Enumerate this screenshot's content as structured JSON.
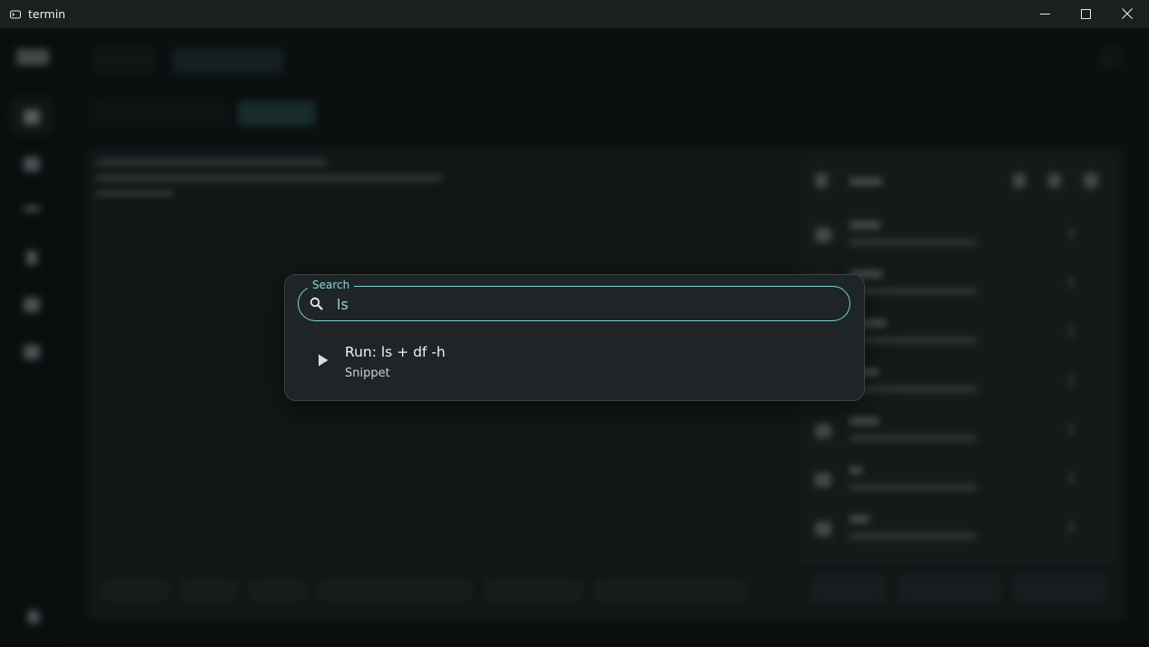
{
  "window": {
    "title": "termin",
    "app_icon": "terminal-cloud-icon",
    "controls": [
      "minimize-icon",
      "maximize-icon",
      "close-icon"
    ]
  },
  "search_dialog": {
    "label": "Search",
    "query": "ls",
    "icon": "search-icon",
    "results": [
      {
        "title": "Run: ls + df -h",
        "subtitle": "Snippet",
        "icon": "play-icon"
      }
    ]
  },
  "colors": {
    "accent": "#7fcfd5",
    "dialog_bg": "#1f2526",
    "titlebar_bg": "#1c1f20"
  }
}
